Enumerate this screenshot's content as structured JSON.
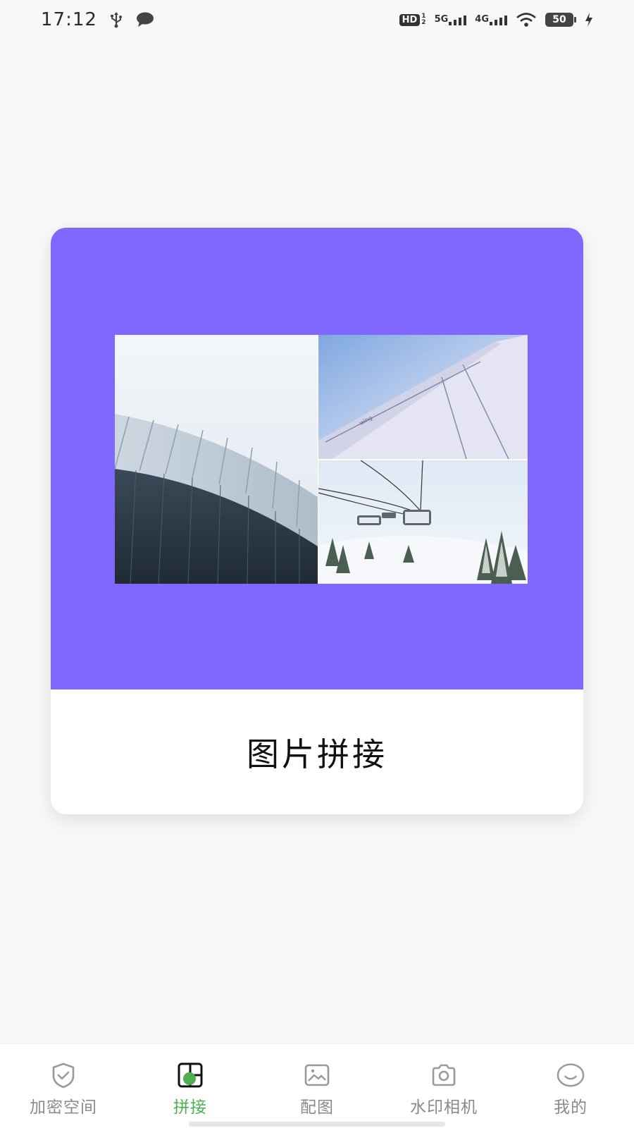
{
  "status_bar": {
    "time": "17:12",
    "left_icons": [
      "usb-icon",
      "chat-bubble-icon"
    ],
    "hd_label": "HD",
    "sim1_network": "5G",
    "sim2_network": "4G",
    "battery_level": "50",
    "charging": true
  },
  "card": {
    "banner_color": "#8068ff",
    "title": "图片拼接",
    "images": [
      "architecture-photo",
      "airplane-wing-photo",
      "ski-lift-photo"
    ]
  },
  "bottom_nav": {
    "active_color": "#4caf50",
    "inactive_color": "#8a8a8a",
    "items": [
      {
        "label": "加密空间",
        "icon": "shield-check-icon"
      },
      {
        "label": "拼接",
        "icon": "collage-icon"
      },
      {
        "label": "配图",
        "icon": "image-icon"
      },
      {
        "label": "水印相机",
        "icon": "camera-icon"
      },
      {
        "label": "我的",
        "icon": "smile-icon"
      }
    ]
  }
}
